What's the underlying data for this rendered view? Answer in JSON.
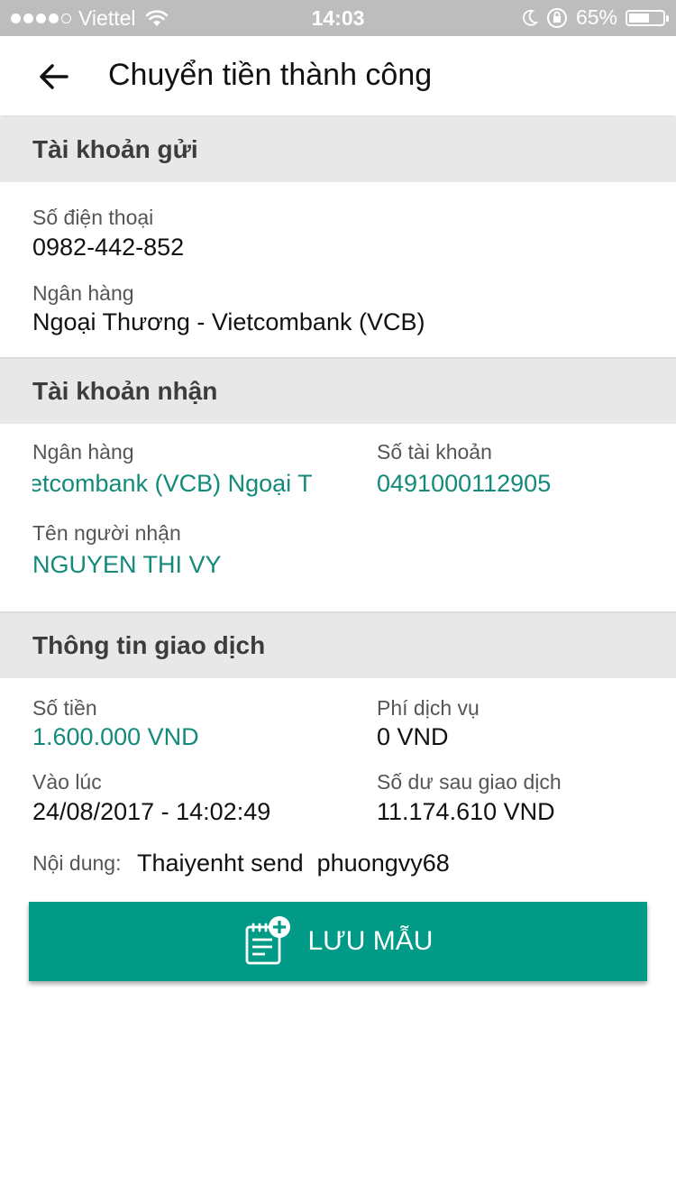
{
  "status_bar": {
    "carrier": "Viettel",
    "time": "14:03",
    "battery_percent_label": "65%",
    "battery_level": 0.65
  },
  "header": {
    "title": "Chuyển tiền thành công"
  },
  "sender": {
    "section_title": "Tài khoản gửi",
    "phone_label": "Số điện thoại",
    "phone_value": "0982-442-852",
    "bank_label": "Ngân hàng",
    "bank_value": "Ngoại Thương - Vietcombank (VCB)"
  },
  "receiver": {
    "section_title": "Tài khoản nhận",
    "bank_label": "Ngân hàng",
    "bank_value_scrolling": "ietcombank (VCB)   Ngoại T",
    "account_label": "Số tài khoản",
    "account_value": "0491000112905",
    "name_label": "Tên người nhận",
    "name_value": "NGUYEN THI VY"
  },
  "transaction": {
    "section_title": "Thông tin giao dịch",
    "amount_label": "Số tiền",
    "amount_value": "1.600.000 VND",
    "fee_label": "Phí dịch vụ",
    "fee_value": "0 VND",
    "time_label": "Vào lúc",
    "time_value": "24/08/2017 - 14:02:49",
    "balance_label": "Số dư sau giao dịch",
    "balance_value": "11.174.610 VND",
    "content_label": "Nội dung:",
    "content_value": "Thaiyenht send  phuongvy68"
  },
  "save_button": {
    "label": "LƯU MẪU",
    "icon": "add-note-icon"
  },
  "colors": {
    "accent": "#009a86",
    "accent_text": "#138a7a",
    "section_bg": "#e8e8e8"
  }
}
